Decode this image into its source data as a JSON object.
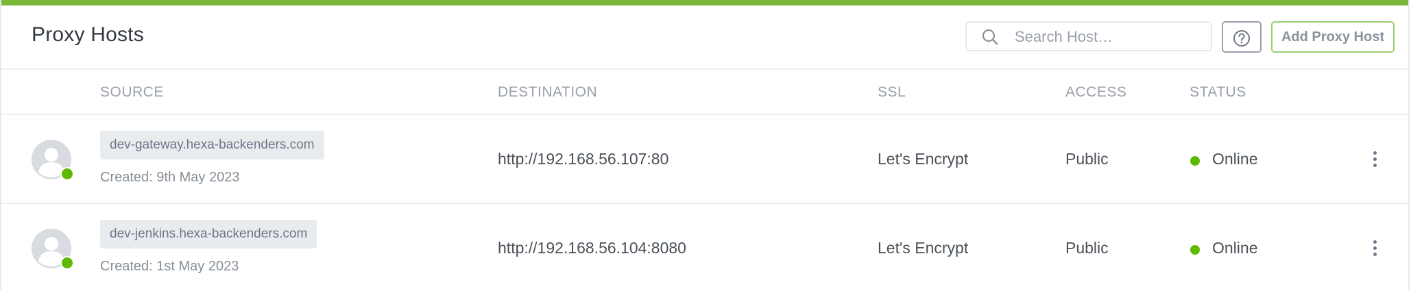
{
  "header": {
    "title": "Proxy Hosts",
    "search_placeholder": "Search Host…",
    "help_icon": "question-circle-icon",
    "add_button_label": "Add Proxy Host"
  },
  "table": {
    "columns": [
      "SOURCE",
      "DESTINATION",
      "SSL",
      "ACCESS",
      "STATUS"
    ],
    "rows": [
      {
        "source": "dev-gateway.hexa-backenders.com",
        "created": "Created: 9th May 2023",
        "destination": "http://192.168.56.107:80",
        "ssl": "Let's Encrypt",
        "access": "Public",
        "status": "Online"
      },
      {
        "source": "dev-jenkins.hexa-backenders.com",
        "created": "Created: 1st May 2023",
        "destination": "http://192.168.56.104:8080",
        "ssl": "Let's Encrypt",
        "access": "Public",
        "status": "Online"
      }
    ]
  },
  "colors": {
    "accent": "#7bb83a",
    "online": "#5eba00",
    "add_button_border": "#9bcd6c"
  }
}
